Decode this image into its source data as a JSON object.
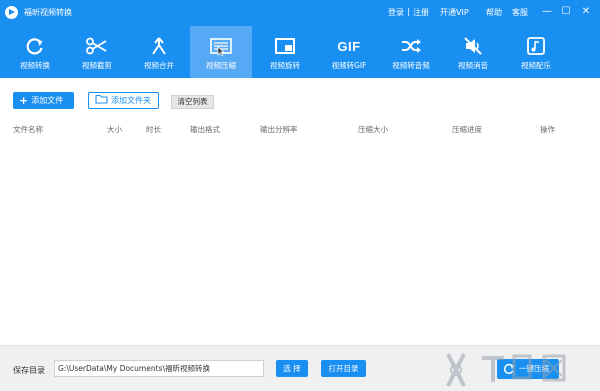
{
  "titlebar": {
    "app_title": "福昕视频转换",
    "login": "登录",
    "separator": "|",
    "register": "注册",
    "vip": "开通VIP",
    "help": "帮助",
    "support": "客服"
  },
  "window_controls": {
    "minimize": "—",
    "maximize": "☐",
    "close": "✕"
  },
  "toolbar": {
    "active_index": 3,
    "items": [
      {
        "label": "视频转换",
        "icon": "convert-icon"
      },
      {
        "label": "视频截剪",
        "icon": "scissors-icon"
      },
      {
        "label": "视频合并",
        "icon": "merge-icon"
      },
      {
        "label": "视频压缩",
        "icon": "compress-icon"
      },
      {
        "label": "视频旋转",
        "icon": "rotate-icon"
      },
      {
        "label": "视频转GIF",
        "icon": "gif-icon",
        "icon_text": "GIF"
      },
      {
        "label": "视频转音频",
        "icon": "shuffle-icon"
      },
      {
        "label": "视频消音",
        "icon": "mute-icon"
      },
      {
        "label": "视频配乐",
        "icon": "music-icon"
      }
    ]
  },
  "actions": {
    "add_file": "添加文件",
    "add_folder": "添加文件夹",
    "clear_list": "清空列表"
  },
  "table": {
    "columns": [
      "文件名称",
      "大小",
      "时长",
      "输出格式",
      "输出分辨率",
      "压缩大小",
      "压缩进度",
      "操作"
    ],
    "rows": []
  },
  "footer": {
    "save_label": "保存目录",
    "save_path": "G:\\UserData\\My Documents\\福昕视频转换",
    "browse": "选 择",
    "open_dir": "打开目录",
    "compress_all": "一键压缩"
  },
  "colors": {
    "accent": "#1a8ff2",
    "accent_active": "#56a9f4",
    "footer_bg": "#f0f0f0"
  }
}
